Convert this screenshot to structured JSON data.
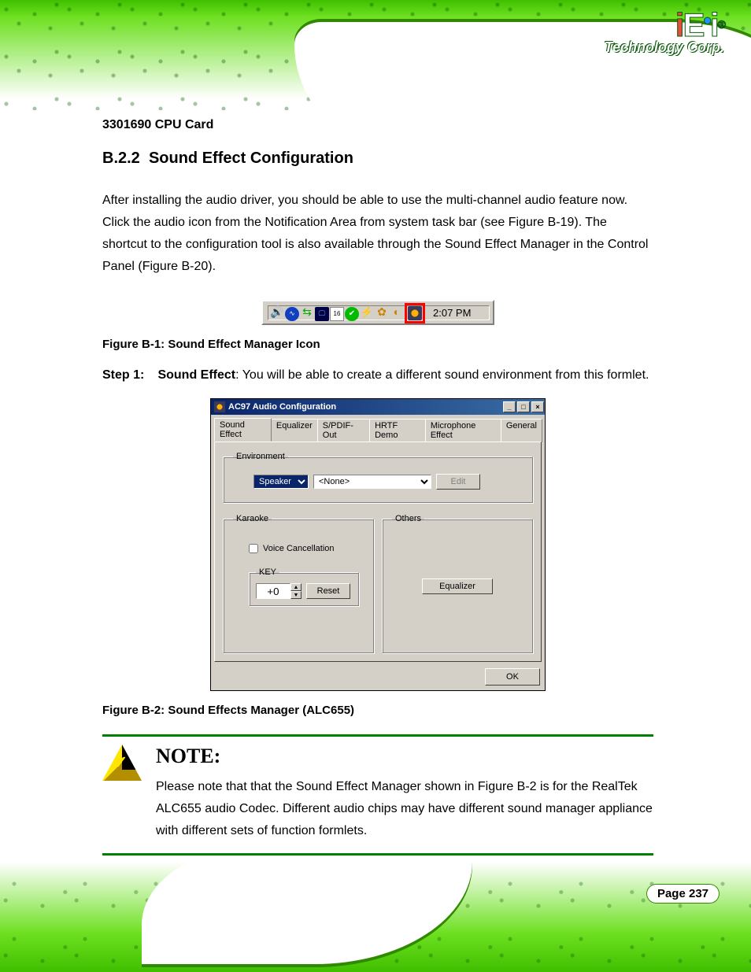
{
  "logo": {
    "iei": "iEi",
    "suffix": "Technology Corp."
  },
  "model": "3301690 CPU Card",
  "sectionNumber": "B.2.2",
  "sectionTitle": "Sound Effect Configuration",
  "intro": "After installing the audio driver, you should be able to use the multi-channel audio feature now. Click the audio icon from the Notification Area from system task bar (see Figure B-19). The shortcut to the configuration tool is also available through the Sound Effect Manager in the Control Panel (Figure B-20).",
  "systray": {
    "time": "2:07 PM",
    "icons": [
      {
        "id": "volume-icon",
        "cls": "ti-vol",
        "glyph": "🔊"
      },
      {
        "id": "wave-icon",
        "cls": "ti-wave",
        "glyph": "∿"
      },
      {
        "id": "network-icon",
        "cls": "ti-net",
        "glyph": "⇆"
      },
      {
        "id": "display-icon",
        "cls": "ti-disp",
        "glyph": "🖵"
      },
      {
        "id": "calendar-icon",
        "cls": "ti-cal",
        "glyph": "16"
      },
      {
        "id": "shield-icon",
        "cls": "ti-shield",
        "glyph": "✔"
      },
      {
        "id": "bolt-icon",
        "cls": "ti-bolt",
        "glyph": "⚡"
      },
      {
        "id": "paw-icon",
        "cls": "ti-paw",
        "glyph": "✿"
      },
      {
        "id": "misc-icon",
        "cls": "ti-misc",
        "glyph": "◐"
      }
    ],
    "highlightIcon": "audio-config-icon"
  },
  "captionTray": "Figure B-1: Sound Effect Manager Icon",
  "step1": {
    "num": "Step 1:",
    "prefix": "",
    "bold": "Sound Effect",
    "rest": ": You will be able to create a different sound environment from this formlet."
  },
  "ac97": {
    "title": "AC97 Audio Configuration",
    "tabs": [
      "Sound Effect",
      "Equalizer",
      "S/PDIF-Out",
      "HRTF Demo",
      "Microphone Effect",
      "General"
    ],
    "activeTab": 0,
    "envGroup": "Environment",
    "speaker": "Speaker",
    "none": "<None>",
    "editBtn": "Edit",
    "karaokeGroup": "Karaoke",
    "voiceCancel": "Voice Cancellation",
    "keyGroup": "KEY",
    "keyValue": "+0",
    "resetBtn": "Reset",
    "othersGroup": "Others",
    "equalizerBtn": "Equalizer",
    "okBtn": "OK"
  },
  "captionDialog": "Figure B-2: Sound Effects Manager (ALC655)",
  "note": {
    "title": "NOTE:",
    "body": "Please note that that the Sound Effect Manager shown in Figure B-2 is for the RealTek ALC655 audio Codec. Different audio chips may have different sound manager appliance with different sets of function formlets."
  },
  "pageNum": "Page 237"
}
